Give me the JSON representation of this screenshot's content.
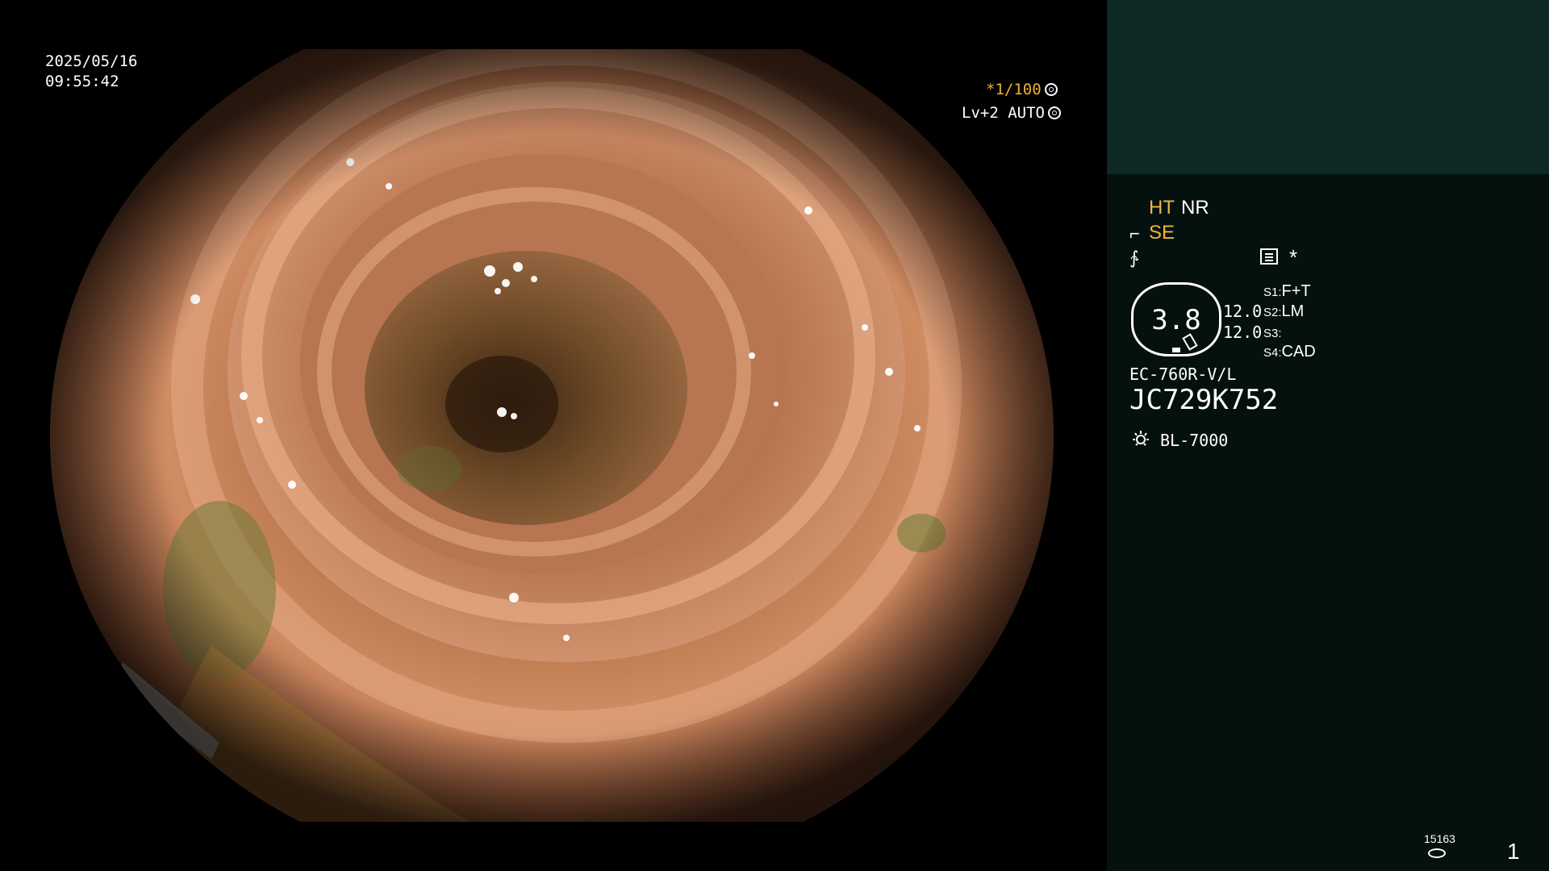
{
  "overlay": {
    "date": "2025/05/16",
    "time": "09:55:42",
    "shutter": "*1/100",
    "exposure": "Lv+2 AUTO"
  },
  "panel": {
    "ht": "HT",
    "nr": "NR",
    "se": "SE",
    "zoom": "3.8",
    "value_1": "12.0",
    "value_2": "12.0",
    "switches": [
      {
        "key": "S1:",
        "value": "F+T"
      },
      {
        "key": "S2:",
        "value": "LM"
      },
      {
        "key": "S3:",
        "value": ""
      },
      {
        "key": "S4:",
        "value": "CAD"
      }
    ],
    "scope_model": "EC-760R-V/L",
    "scope_serial": "JC729K752",
    "light_source": "BL-7000",
    "disk_count": "15163",
    "page_number": "1"
  },
  "colors": {
    "panel_bg": "#04110f",
    "panel_top_bg": "#0d2825",
    "amber": "#f2b535",
    "mucosa": "#c9805a"
  },
  "icons": {
    "shutter": "aperture-icon",
    "exposure": "iris-icon",
    "structure": "structure-enhance-icon",
    "curve": "tone-curve-icon",
    "list": "list-icon",
    "light": "light-source-icon",
    "disk": "disk-icon"
  }
}
